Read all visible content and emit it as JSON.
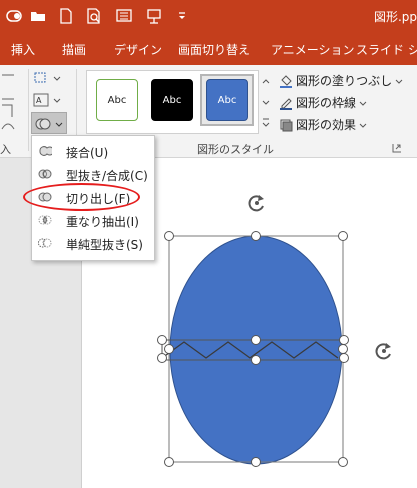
{
  "title_bar": {
    "doc_title": "図形.pp",
    "icons": [
      "autosave-icon",
      "open-folder-icon",
      "new-document-icon",
      "print-preview-icon",
      "slide-icon",
      "presenter-icon",
      "customize-qat-icon"
    ]
  },
  "tabs": [
    {
      "label": "挿入"
    },
    {
      "label": "描画"
    },
    {
      "label": "デザイン"
    },
    {
      "label": "画面切り替え"
    },
    {
      "label": "アニメーション"
    },
    {
      "label": "スライド ショ"
    }
  ],
  "ribbon": {
    "left_group_label": "入",
    "shape_styles": [
      {
        "label": "Abc",
        "fill": "#ffffff",
        "border": "#70ad47",
        "text": "#222222"
      },
      {
        "label": "Abc",
        "fill": "#000000",
        "border": "#000000",
        "text": "#ffffff"
      },
      {
        "label": "Abc",
        "fill": "#4472c4",
        "border": "#2f528f",
        "text": "#ffffff"
      }
    ],
    "commands": [
      {
        "label": "図形の塗りつぶし",
        "has_dropdown": true
      },
      {
        "label": "図形の枠線",
        "has_dropdown": true
      },
      {
        "label": "図形の効果",
        "has_dropdown": true
      }
    ],
    "style_group_label": "図形のスタイル"
  },
  "merge_menu": {
    "items": [
      {
        "label": "接合(U)"
      },
      {
        "label": "型抜き/合成(C)"
      },
      {
        "label": "切り出し(F)",
        "circled": true
      },
      {
        "label": "重なり抽出(I)"
      },
      {
        "label": "単純型抜き(S)"
      }
    ]
  },
  "colors": {
    "accent": "#c43e1c",
    "shape_fill": "#4472c4",
    "highlight": "#e51d1d"
  }
}
